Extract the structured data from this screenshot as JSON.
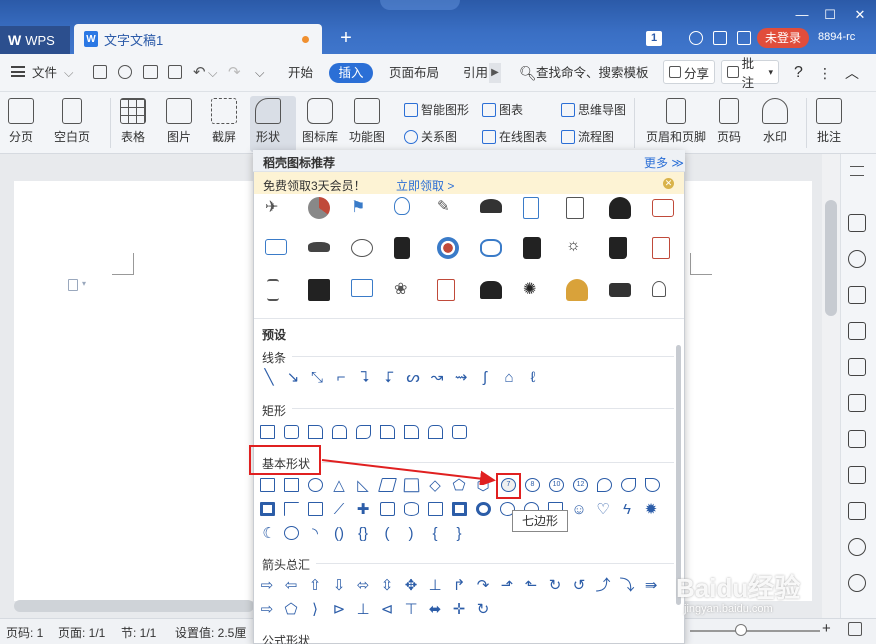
{
  "titlebar": {
    "app_tab": "WPS",
    "doc_tab": "文字文稿1",
    "doc_icon": "W",
    "badge": "1",
    "login": "未登录",
    "user_id": "8894-rc"
  },
  "menu": {
    "file": "文件",
    "items": [
      "开始",
      "插入",
      "页面布局",
      "引用"
    ],
    "search": "查找命令、搜索模板",
    "share": "分享",
    "comment": "批注",
    "help": "?"
  },
  "ribbon": {
    "page_break": "分页",
    "blank_page": "空白页",
    "table": "表格",
    "picture": "图片",
    "screenshot": "截屏",
    "shape": "形状",
    "icon_lib": "图标库",
    "function_chart": "功能图",
    "smart_shape": "智能图形",
    "chart": "图表",
    "mind_map": "思维导图",
    "relation": "关系图",
    "online_chart": "在线图表",
    "flowchart": "流程图",
    "header_footer": "页眉和页脚",
    "page_number": "页码",
    "watermark": "水印",
    "annotate": "批注"
  },
  "panel": {
    "title": "稻壳图标推荐",
    "more": "更多",
    "promo_text": "免费领取3天会员！",
    "promo_link": "立即领取 >",
    "preset": "预设",
    "sections": {
      "lines": "线条",
      "rect": "矩形",
      "basic": "基本形状",
      "arrows": "箭头总汇",
      "formula": "公式形状"
    },
    "basic_number_labels": [
      "7",
      "8",
      "10",
      "12"
    ],
    "tooltip": "七边形"
  },
  "status": {
    "page_code": "页码: 1",
    "pages": "页面: 1/1",
    "section": "节: 1/1",
    "setting": "设置值: 2.5厘"
  },
  "watermark": {
    "brand": "Baidu经验",
    "url": "jingyan.baidu.com"
  }
}
